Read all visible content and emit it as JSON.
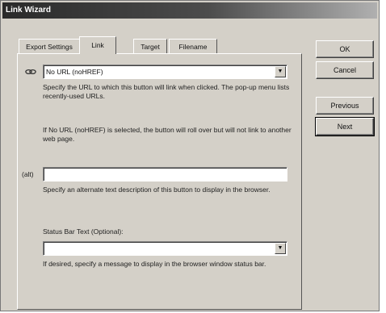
{
  "window": {
    "title": "Link Wizard"
  },
  "tabs": [
    {
      "label": "Export Settings"
    },
    {
      "label": "Link"
    },
    {
      "label": "Target"
    },
    {
      "label": "Filename"
    }
  ],
  "url": {
    "value": "No URL (noHREF)",
    "help1": "Specify the URL to which this button will link when clicked. The pop-up menu lists recently-used URLs.",
    "help2": "If No URL (noHREF) is selected, the button will roll over but will not link to another web page."
  },
  "alt": {
    "label": "(alt)",
    "value": "",
    "help": "Specify an alternate text description of this button to display in the browser."
  },
  "status": {
    "label": "Status Bar Text (Optional):",
    "value": "",
    "help": "If desired, specify a message to display in the browser window status bar."
  },
  "buttons": {
    "ok": "OK",
    "cancel": "Cancel",
    "previous": "Previous",
    "next": "Next"
  },
  "icons": {
    "url": "link-chain-icon",
    "dropdown": "chevron-down-icon"
  }
}
